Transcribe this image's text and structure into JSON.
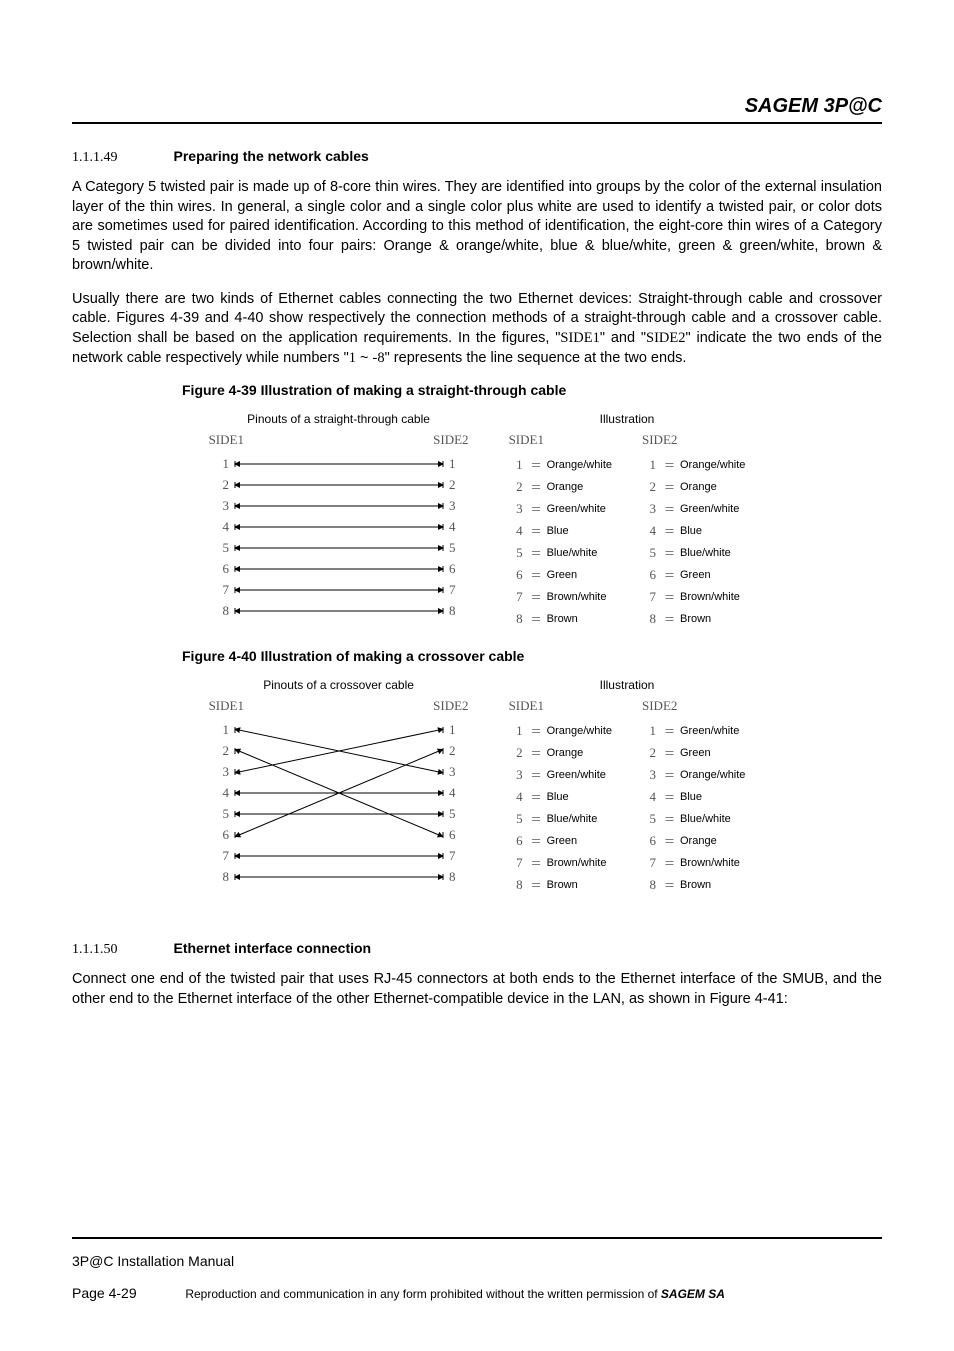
{
  "header": {
    "brand": "SAGEM 3P@C"
  },
  "section1": {
    "num": "1.1.1.49",
    "title": "Preparing the network cables",
    "para1": "A Category 5 twisted pair is made up of 8-core thin wires. They are identified into groups by the color of the external insulation layer of the thin wires. In general, a single color and a single color plus white are used to identify a twisted pair, or color dots are sometimes used for paired identification. According to this method of identification, the eight-core thin wires of a Category 5 twisted pair can be divided into four pairs: Orange & orange/white, blue & blue/white, green & green/white, brown & brown/white.",
    "para2a": "Usually there are two kinds of Ethernet cables connecting the two Ethernet devices: Straight-through cable and crossover cable. Figures 4-39 and 4-40 show respectively the connection methods of a straight-through cable and a crossover cable. Selection shall be based on the application requirements. In the figures, \"",
    "para2b": "\" and \"",
    "para2c": "\" indicate the two ends of the network cable respectively while numbers \"",
    "para2d": "\" represents the line sequence at the two ends.",
    "side1": "SIDE1",
    "side2": "SIDE2",
    "rangeStart": "1",
    "rangeSep": " ~ ",
    "rangeEnd": "-8"
  },
  "fig39": {
    "caption": "Figure 4-39 Illustration of making a straight-through cable",
    "pinout_title": "Pinouts of a straight-through cable",
    "illus_title": "Illustration",
    "side1": "SIDE1",
    "side2": "SIDE2",
    "pins": [
      "1",
      "2",
      "3",
      "4",
      "5",
      "6",
      "7",
      "8"
    ],
    "mapping": [
      [
        1,
        1
      ],
      [
        2,
        2
      ],
      [
        3,
        3
      ],
      [
        4,
        4
      ],
      [
        5,
        5
      ],
      [
        6,
        6
      ],
      [
        7,
        7
      ],
      [
        8,
        8
      ]
    ],
    "illus_side1": [
      "Orange/white",
      "Orange",
      "Green/white",
      "Blue",
      "Blue/white",
      "Green",
      "Brown/white",
      "Brown"
    ],
    "illus_side2": [
      "Orange/white",
      "Orange",
      "Green/white",
      "Blue",
      "Blue/white",
      "Green",
      "Brown/white",
      "Brown"
    ]
  },
  "fig40": {
    "caption": "Figure 4-40 Illustration of making a crossover cable",
    "pinout_title": "Pinouts of a crossover cable",
    "illus_title": "Illustration",
    "side1": "SIDE1",
    "side2": "SIDE2",
    "pins": [
      "1",
      "2",
      "3",
      "4",
      "5",
      "6",
      "7",
      "8"
    ],
    "mapping": [
      [
        1,
        3
      ],
      [
        2,
        6
      ],
      [
        3,
        1
      ],
      [
        4,
        4
      ],
      [
        5,
        5
      ],
      [
        6,
        2
      ],
      [
        7,
        7
      ],
      [
        8,
        8
      ]
    ],
    "illus_side1": [
      "Orange/white",
      "Orange",
      "Green/white",
      "Blue",
      "Blue/white",
      "Green",
      "Brown/white",
      "Brown"
    ],
    "illus_side2": [
      "Green/white",
      "Green",
      "Orange/white",
      "Blue",
      "Blue/white",
      "Orange",
      "Brown/white",
      "Brown"
    ]
  },
  "section2": {
    "num": "1.1.1.50",
    "title": "Ethernet interface connection",
    "para": "Connect one end of the twisted pair that uses RJ-45 connectors at both ends to the Ethernet interface of the SMUB, and the other end to the Ethernet interface of the other Ethernet-compatible device in the LAN, as shown in Figure 4-41:"
  },
  "footer": {
    "line1": "3P@C Installation Manual",
    "page": "Page 4-29",
    "repro": "Reproduction and communication in any form prohibited without the written permission of ",
    "company": "SAGEM SA"
  }
}
